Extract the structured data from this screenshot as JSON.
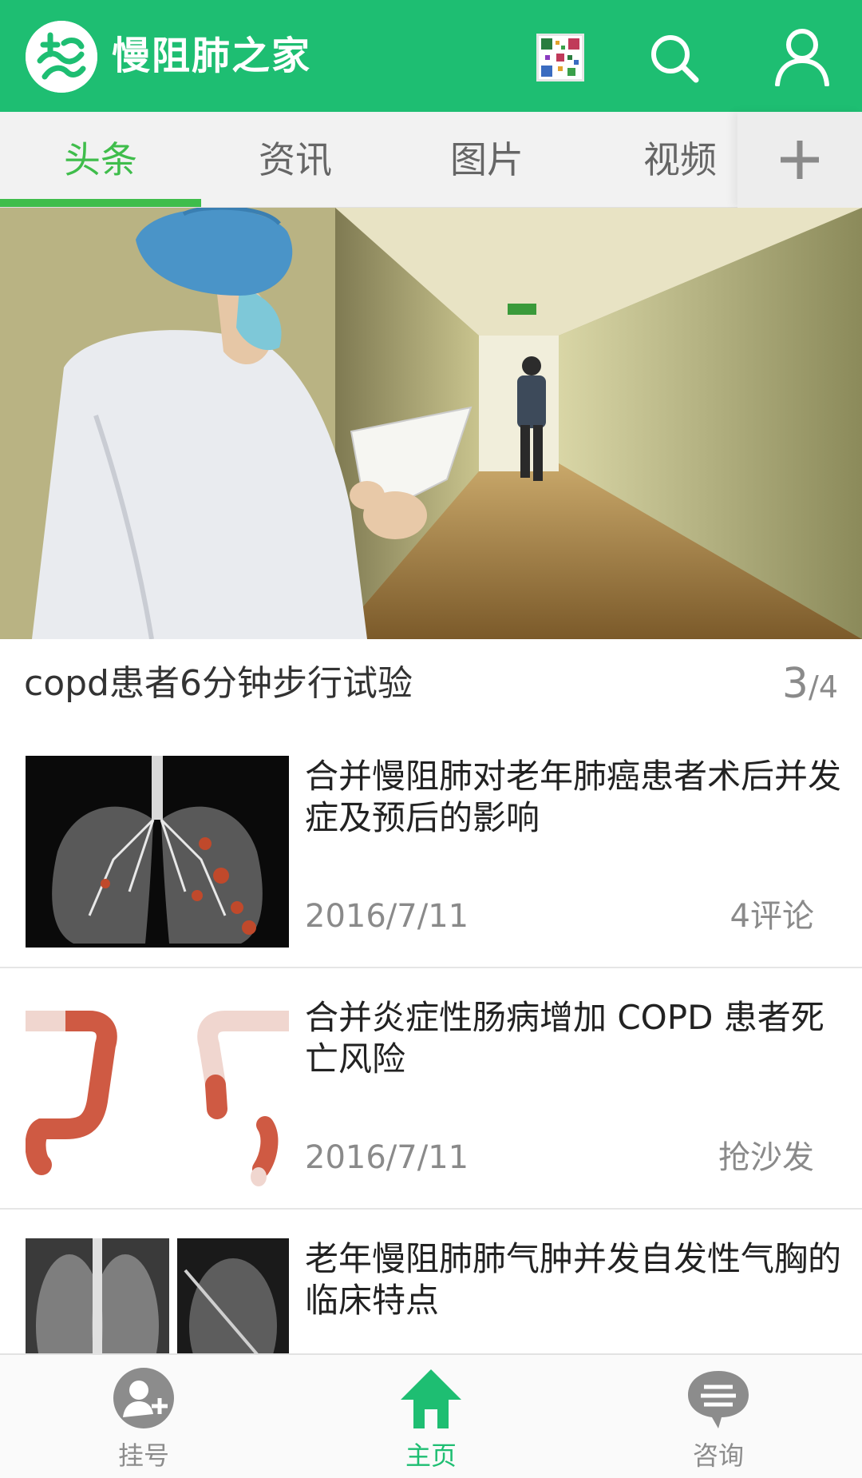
{
  "header": {
    "title": "慢阻肺之家",
    "logo_icon": "app-logo-icon",
    "qr_icon": "qr-code-icon",
    "search_icon": "search-icon",
    "user_icon": "user-icon",
    "brand_color": "#1ebe72"
  },
  "tabs": {
    "items": [
      {
        "label": "头条",
        "active": true
      },
      {
        "label": "资讯",
        "active": false
      },
      {
        "label": "图片",
        "active": false
      },
      {
        "label": "视频",
        "active": false
      }
    ],
    "add_icon": "plus-icon",
    "active_color": "#3fbd4b"
  },
  "hero": {
    "caption": "copd患者6分钟步行试验",
    "pager_current": "3",
    "pager_separator": "/",
    "pager_total": "4"
  },
  "news": [
    {
      "title": "合并慢阻肺对老年肺癌患者术后并发症及预后的影响",
      "date": "2016/7/11",
      "comments": "4评论",
      "thumb": "lung-xray-illustration"
    },
    {
      "title": "合并炎症性肠病增加 COPD 患者死亡风险",
      "date": "2016/7/11",
      "comments": "抢沙发",
      "thumb": "colon-illustration"
    },
    {
      "title": "老年慢阻肺肺气肿并发自发性气胸的临床特点",
      "date": "",
      "comments": "",
      "thumb": "chest-xray-photos"
    }
  ],
  "bottom_nav": {
    "items": [
      {
        "label": "挂号",
        "icon": "add-user-icon",
        "active": false
      },
      {
        "label": "主页",
        "icon": "home-icon",
        "active": true
      },
      {
        "label": "咨询",
        "icon": "chat-icon",
        "active": false
      }
    ]
  }
}
